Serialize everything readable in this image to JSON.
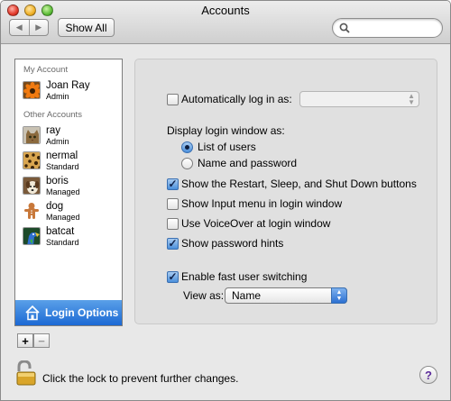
{
  "window": {
    "title": "Accounts"
  },
  "toolbar": {
    "back_glyph": "◀",
    "forward_glyph": "▶",
    "show_all_label": "Show All",
    "search_placeholder": "",
    "search_value": ""
  },
  "sidebar": {
    "my_account_header": "My Account",
    "my_account": {
      "name": "Joan Ray",
      "role": "Admin",
      "avatar": "flower"
    },
    "other_accounts_header": "Other Accounts",
    "others": [
      {
        "name": "ray",
        "role": "Admin",
        "avatar": "cat"
      },
      {
        "name": "nermal",
        "role": "Standard",
        "avatar": "leopard-fur"
      },
      {
        "name": "boris",
        "role": "Managed",
        "avatar": "dog-photo"
      },
      {
        "name": "dog",
        "role": "Managed",
        "avatar": "gingerbread-man"
      },
      {
        "name": "batcat",
        "role": "Standard",
        "avatar": "parrot"
      }
    ],
    "login_options_label": "Login Options",
    "add_label": "+",
    "remove_label": "−"
  },
  "options": {
    "auto_login_label": "Automatically log in as:",
    "auto_login_checked": false,
    "auto_login_value": "",
    "display_login_label": "Display login window as:",
    "radio_list_label": "List of users",
    "radio_list_selected": true,
    "radio_name_label": "Name and password",
    "radio_name_selected": false,
    "show_restart_label": "Show the Restart, Sleep, and Shut Down buttons",
    "show_restart_checked": true,
    "show_input_menu_label": "Show Input menu in login window",
    "show_input_menu_checked": false,
    "voiceover_label": "Use VoiceOver at login window",
    "voiceover_checked": false,
    "password_hints_label": "Show password hints",
    "password_hints_checked": true,
    "fast_switch_label": "Enable fast user switching",
    "fast_switch_checked": true,
    "view_as_label": "View as:",
    "view_as_value": "Name"
  },
  "footer": {
    "lock_text": "Click the lock to prevent further changes.",
    "help_label": "?"
  },
  "colors": {
    "selection_blue": "#1c69d4",
    "window_bg": "#e8e8e8",
    "panel_bg": "#e0e0e0"
  }
}
